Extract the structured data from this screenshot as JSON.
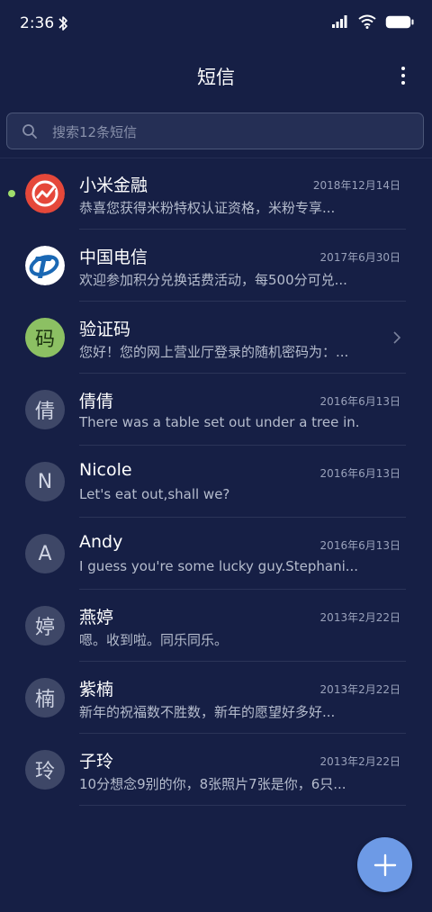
{
  "status_bar": {
    "time": "2:36",
    "icons": [
      "bluetooth-icon",
      "signal-icon",
      "wifi-icon",
      "battery-icon"
    ]
  },
  "header": {
    "title": "短信",
    "menu_icon": "more-vert-icon"
  },
  "search": {
    "placeholder": "搜索12条短信",
    "icon": "search-icon"
  },
  "colors": {
    "background": "#161f45",
    "unread_dot": "#9fdd6b",
    "fab": "#6d9ae6",
    "code_avatar": "#8cc063",
    "mi_finance_avatar": "#e5483a",
    "telecom_avatar": "#1a68b4"
  },
  "conversations": [
    {
      "avatar": "",
      "avatar_icon": "mi-finance-logo-icon",
      "name": "小米金融",
      "date": "2018年12月14日",
      "preview": "恭喜您获得米粉特权认证资格，米粉专享...",
      "unread": true
    },
    {
      "avatar": "",
      "avatar_icon": "china-telecom-logo-icon",
      "name": "中国电信",
      "date": "2017年6月30日",
      "preview": "欢迎参加积分兑换话费活动，每500分可兑..."
    },
    {
      "avatar": "码",
      "name": "验证码",
      "date": "",
      "preview": "您好！您的网上营业厅登录的随机密码为：...",
      "chevron": true
    },
    {
      "avatar": "倩",
      "name": "倩倩",
      "date": "2016年6月13日",
      "preview": "There was a table set out under a tree in..."
    },
    {
      "avatar": "N",
      "name": "Nicole",
      "date": "2016年6月13日",
      "preview": "Let's eat out,shall we?"
    },
    {
      "avatar": "A",
      "name": "Andy",
      "date": "2016年6月13日",
      "preview": "I guess you're some lucky guy.Stephani..."
    },
    {
      "avatar": "婷",
      "name": "燕婷",
      "date": "2013年2月22日",
      "preview": "嗯。收到啦。同乐同乐。"
    },
    {
      "avatar": "楠",
      "name": "紫楠",
      "date": "2013年2月22日",
      "preview": "新年的祝福数不胜数，新年的愿望好多好..."
    },
    {
      "avatar": "玲",
      "name": "子玲",
      "date": "2013年2月22日",
      "preview": "10分想念9别的你，8张照片7张是你，6只..."
    }
  ],
  "fab": {
    "icon": "plus-icon"
  }
}
